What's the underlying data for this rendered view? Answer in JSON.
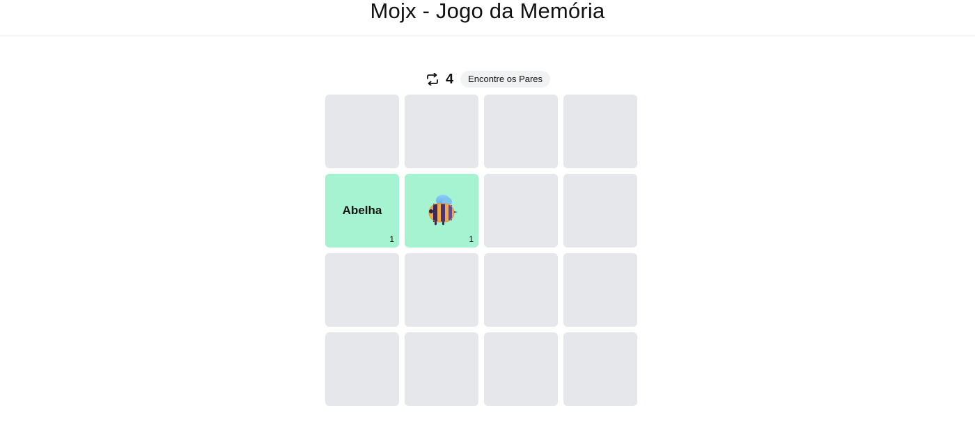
{
  "header": {
    "title": "Mojx - Jogo da Memória"
  },
  "status": {
    "moves_icon": "repeat-icon",
    "moves": "4",
    "hint": "Encontre os Pares"
  },
  "board": {
    "columns": 4,
    "rows": 4,
    "colors": {
      "hidden": "#e6e7ea",
      "matched": "#a5f3d0"
    },
    "cards": [
      {
        "state": "hidden"
      },
      {
        "state": "hidden"
      },
      {
        "state": "hidden"
      },
      {
        "state": "hidden"
      },
      {
        "state": "matched",
        "kind": "word",
        "label": "Abelha",
        "count": "1"
      },
      {
        "state": "matched",
        "kind": "emoji",
        "icon": "bee-icon",
        "count": "1"
      },
      {
        "state": "hidden"
      },
      {
        "state": "hidden"
      },
      {
        "state": "hidden"
      },
      {
        "state": "hidden"
      },
      {
        "state": "hidden"
      },
      {
        "state": "hidden"
      },
      {
        "state": "hidden"
      },
      {
        "state": "hidden"
      },
      {
        "state": "hidden"
      },
      {
        "state": "hidden"
      }
    ]
  }
}
